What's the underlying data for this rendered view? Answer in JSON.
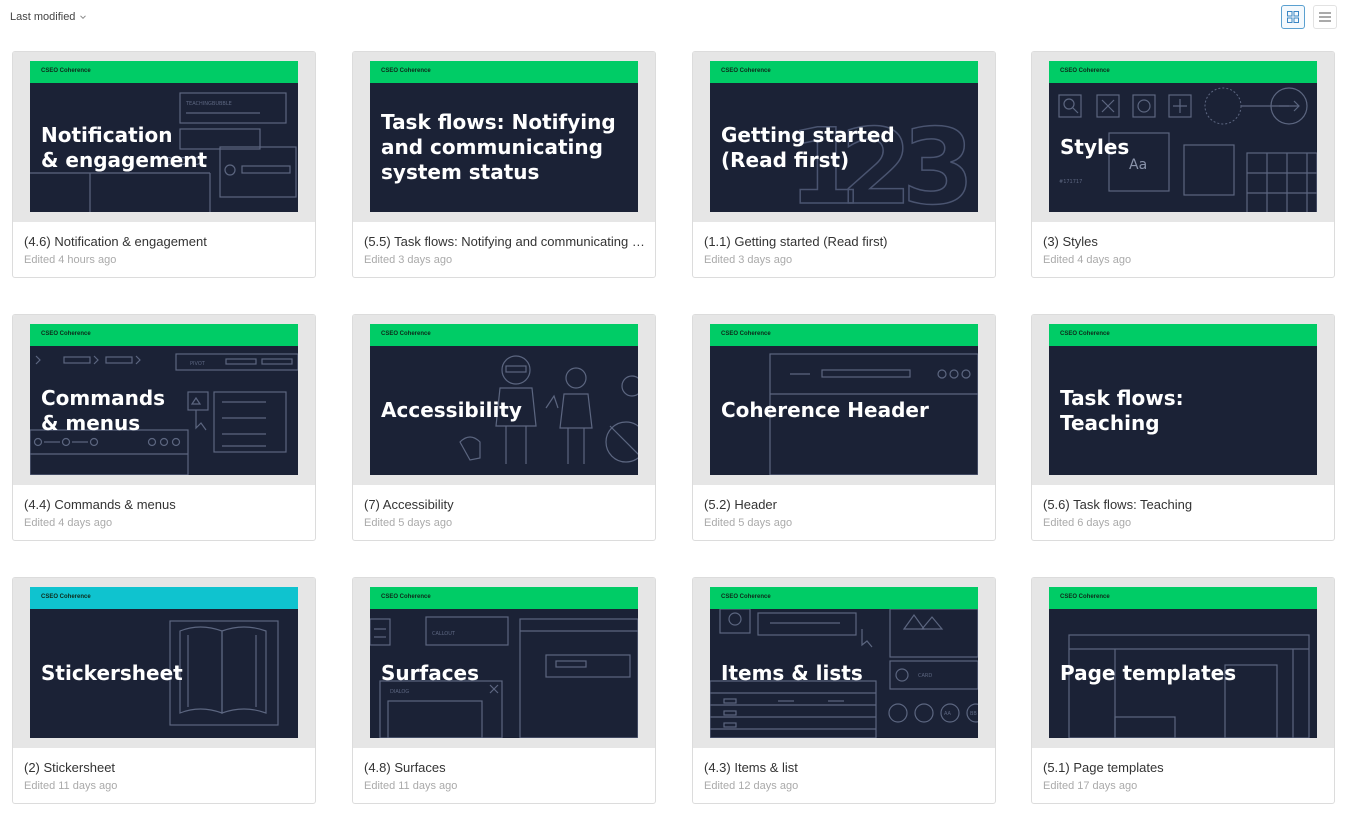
{
  "toolbar": {
    "sort_label": "Last modified",
    "sort_icon": "chevron-down-icon",
    "grid_view_icon": "grid-view-icon",
    "list_view_icon": "list-view-icon"
  },
  "colors": {
    "thumb_bg": "#1b2236",
    "brand_band": "#00cc66",
    "brand_band_alt": "#0fc3cf",
    "selected_view": "#5aa0d0"
  },
  "files": [
    {
      "name": "(4.6) Notification & engagement",
      "edited": "Edited 4 hours ago",
      "brand": "CSEO Coherence",
      "thumb_title": "Notification\n& engagement",
      "band": "green",
      "art": "notification"
    },
    {
      "name": "(5.5) Task flows: Notifying and communicating system status",
      "edited": "Edited 3 days ago",
      "brand": "CSEO Coherence",
      "thumb_title": "Task flows: Notifying\nand communicating\nsystem status",
      "band": "green",
      "art": "none"
    },
    {
      "name": "(1.1) Getting started (Read first)",
      "edited": "Edited 3 days ago",
      "brand": "CSEO Coherence",
      "thumb_title": "Getting started\n(Read first)",
      "band": "green",
      "art": "numbers"
    },
    {
      "name": "(3) Styles",
      "edited": "Edited 4 days ago",
      "brand": "CSEO Coherence",
      "thumb_title": "Styles",
      "band": "green",
      "art": "styles"
    },
    {
      "name": "(4.4) Commands & menus",
      "edited": "Edited 4 days ago",
      "brand": "CSEO Coherence",
      "thumb_title": "Commands\n& menus",
      "band": "green",
      "art": "commands"
    },
    {
      "name": "(7) Accessibility",
      "edited": "Edited 5 days ago",
      "brand": "CSEO Coherence",
      "thumb_title": "Accessibility",
      "band": "green",
      "art": "accessibility"
    },
    {
      "name": "(5.2) Header",
      "edited": "Edited 5 days ago",
      "brand": "CSEO Coherence",
      "thumb_title": "Coherence Header",
      "band": "green",
      "art": "header"
    },
    {
      "name": "(5.6) Task flows: Teaching",
      "edited": "Edited 6 days ago",
      "brand": "CSEO Coherence",
      "thumb_title": "Task flows:\nTeaching",
      "band": "green",
      "art": "none"
    },
    {
      "name": "(2) Stickersheet",
      "edited": "Edited 11 days ago",
      "brand": "CSEO Coherence",
      "thumb_title": "Stickersheet",
      "band": "teal",
      "art": "book"
    },
    {
      "name": "(4.8) Surfaces",
      "edited": "Edited 11 days ago",
      "brand": "CSEO Coherence",
      "thumb_title": "Surfaces",
      "band": "green",
      "art": "surfaces"
    },
    {
      "name": "(4.3) Items & list",
      "edited": "Edited 12 days ago",
      "brand": "CSEO Coherence",
      "thumb_title": "Items & lists",
      "band": "green",
      "art": "items"
    },
    {
      "name": "(5.1) Page templates",
      "edited": "Edited 17 days ago",
      "brand": "CSEO Coherence",
      "thumb_title": "Page templates",
      "band": "green",
      "art": "templates"
    }
  ],
  "art_text": {
    "notification": [
      "TEACHINGBUBBLE"
    ],
    "numbers": [
      "1",
      "2",
      "3"
    ],
    "styles": [
      "Aa",
      "#171717"
    ],
    "commands": [
      "PIVOT"
    ],
    "surfaces": [
      "CALLOUT",
      "DIALOG"
    ],
    "items": [
      "CARD",
      "AA",
      "BB"
    ]
  }
}
